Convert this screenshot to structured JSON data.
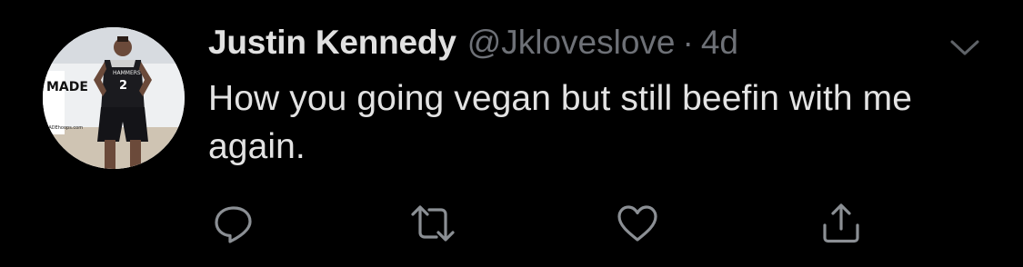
{
  "tweet": {
    "display_name": "Justin Kennedy",
    "handle": "@Jkloveslove",
    "separator": "·",
    "time": "4d",
    "text": "How you going vegan but still beefin with me again."
  },
  "avatar": {
    "jersey_number": "2",
    "jersey_text": "HAMMERS",
    "banner_text": "MADE",
    "site_text": "MADEhoops.com"
  },
  "icons": {
    "menu": "chevron-down-icon",
    "reply": "reply-icon",
    "retweet": "retweet-icon",
    "like": "heart-icon",
    "share": "share-icon"
  },
  "colors": {
    "background": "#000000",
    "name": "#e1e1e1",
    "secondary": "#6e7177",
    "body": "#e3e3e3",
    "icon": "#8b8f94"
  }
}
